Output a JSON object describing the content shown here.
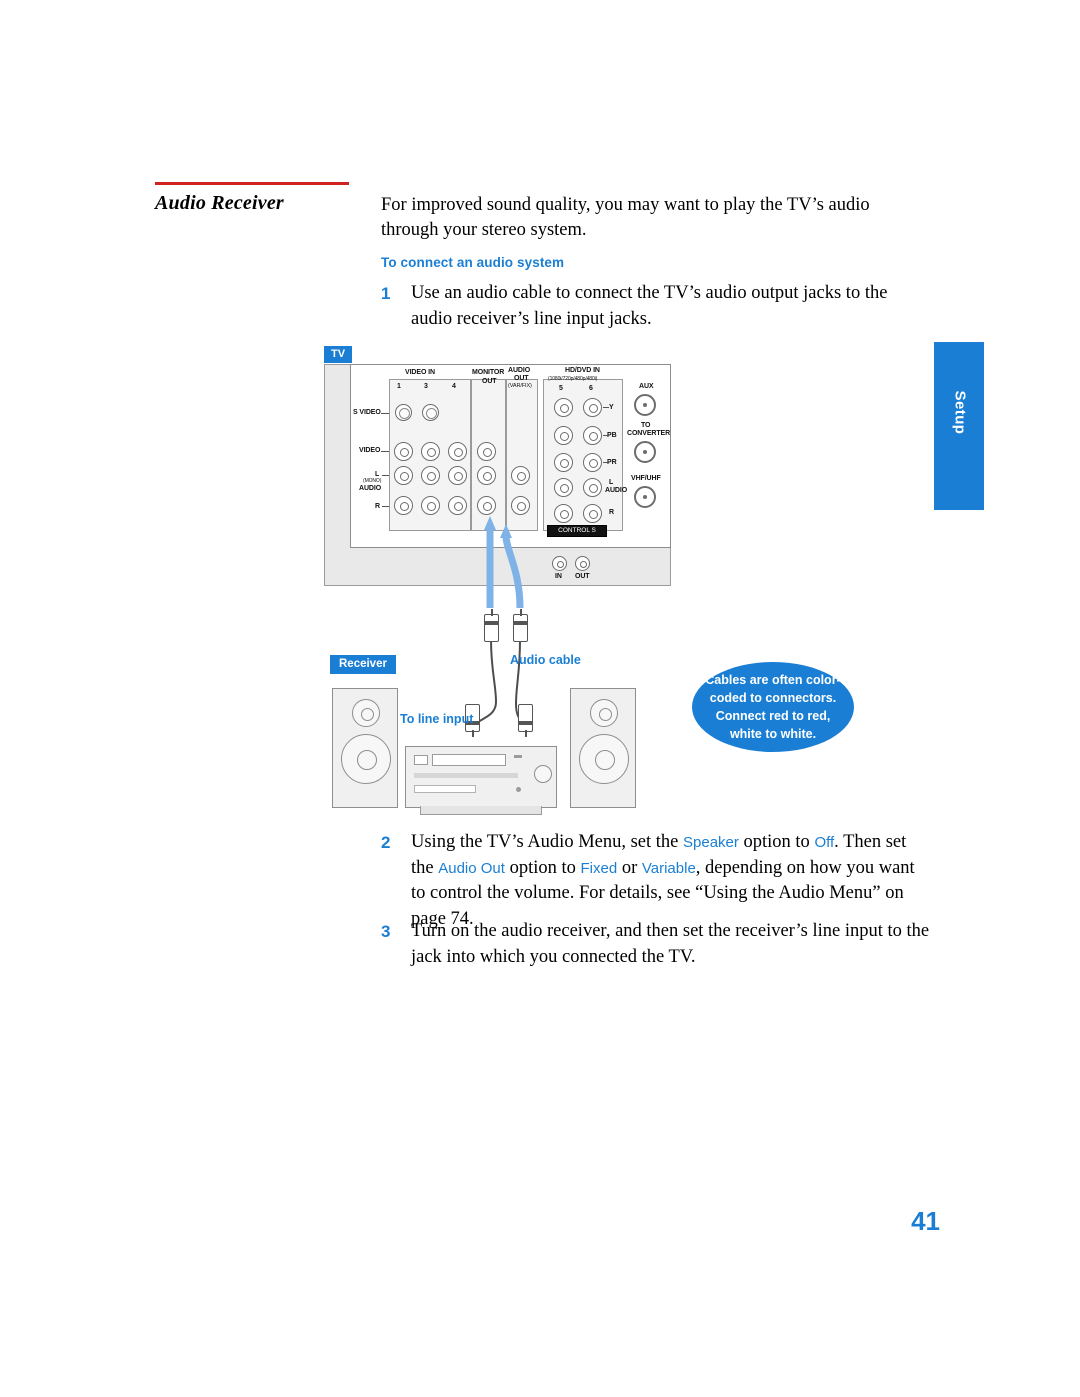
{
  "heading": {
    "title": "Audio Receiver",
    "rule_color": "#d1211c"
  },
  "intro": "For improved sound quality, you may want to play the TV’s audio through your stereo system.",
  "subhead": "To connect an audio system",
  "steps": [
    {
      "num": "1",
      "text": "Use an audio cable to connect the TV’s audio output jacks to the audio receiver’s line input jacks."
    },
    {
      "num": "2",
      "text_parts": {
        "p1": "Using the TV’s Audio Menu, set the ",
        "t1": "Speaker",
        "p2": " option to ",
        "t2": "Off",
        "p3": ". Then set the ",
        "t3": "Audio Out",
        "p4": " option to ",
        "t4": "Fixed",
        "p5": " or ",
        "t5": "Variable",
        "p6": ", depending on how you want to control the volume. For details, see “Using the Audio Menu” on page 74."
      }
    },
    {
      "num": "3",
      "text": "Turn on the audio receiver, and then set the receiver’s line input to the jack into which you connected the TV."
    }
  ],
  "side_tab": {
    "label": "Setup",
    "color": "#1a7fd4"
  },
  "page_number": "41",
  "diagram": {
    "tv_label": "TV",
    "receiver_label": "Receiver",
    "audio_cable_label": "Audio cable",
    "to_line_input_label": "To line input",
    "callout": "Cables are often color-coded to connectors. Connect red to red, white to white.",
    "jack_labels": {
      "video_in": "VIDEO IN",
      "n1": "1",
      "n3": "3",
      "n4": "4",
      "monitor": "MONITOR",
      "monitor_out": "OUT",
      "audio": "AUDIO",
      "audio_out": "OUT",
      "audio_out_sub": "(VAR/FIX)",
      "hd_dvd_in": "HD/DVD IN",
      "hd_dvd_sub": "(1080i/720p/480p/480i)",
      "n5": "5",
      "n6": "6",
      "aux": "AUX",
      "to": "TO",
      "converter": "CONVERTER",
      "vhf_uhf": "VHF/UHF",
      "control_s": "CONTROL S",
      "in": "IN",
      "out": "OUT",
      "s_video": "S VIDEO",
      "video": "VIDEO",
      "l_mono": "L",
      "mono": "(MONO)",
      "audio_left": "AUDIO",
      "r": "R",
      "y": "Y",
      "pb": "PB",
      "pr": "PR",
      "audio_r": "AUDIO",
      "l": "L",
      "r2": "R"
    }
  }
}
